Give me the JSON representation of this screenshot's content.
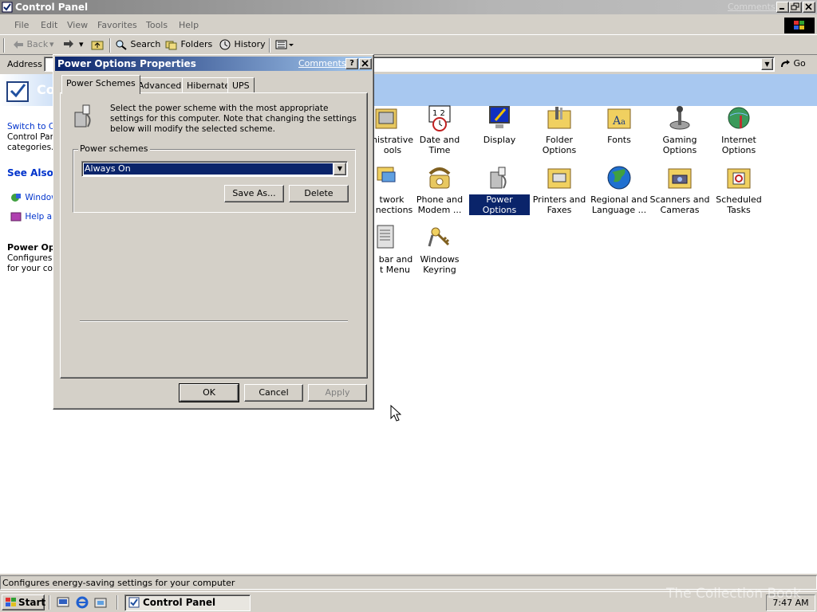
{
  "main_window": {
    "title": "Control Panel",
    "comments_link": "Comments?",
    "menu": [
      "File",
      "Edit",
      "View",
      "Favorites",
      "Tools",
      "Help"
    ],
    "toolbar": {
      "back": "Back",
      "search": "Search",
      "folders": "Folders",
      "history": "History"
    },
    "address_label": "Address",
    "go_label": "Go"
  },
  "sidebar": {
    "title": "Co",
    "switch_text_1": "Switch to C",
    "switch_text_2": "Control Pan",
    "switch_text_3": "categories.",
    "see_also": "See Also",
    "link_1": "Window",
    "link_2": "Help ar",
    "selected_title": "Power Opt",
    "selected_desc_1": "Configures",
    "selected_desc_2": "for your com"
  },
  "icons": [
    {
      "label_1": "nistrative",
      "label_2": "ools"
    },
    {
      "label_1": "Date and Time",
      "label_2": ""
    },
    {
      "label_1": "Display",
      "label_2": ""
    },
    {
      "label_1": "Folder Options",
      "label_2": ""
    },
    {
      "label_1": "Fonts",
      "label_2": ""
    },
    {
      "label_1": "Gaming",
      "label_2": "Options"
    },
    {
      "label_1": "Internet",
      "label_2": "Options"
    },
    {
      "label_1": "twork",
      "label_2": "nections"
    },
    {
      "label_1": "Phone and",
      "label_2": "Modem ..."
    },
    {
      "label_1": "Power Options",
      "label_2": ""
    },
    {
      "label_1": "Printers and",
      "label_2": "Faxes"
    },
    {
      "label_1": "Regional and",
      "label_2": "Language ..."
    },
    {
      "label_1": "Scanners and",
      "label_2": "Cameras"
    },
    {
      "label_1": "Scheduled",
      "label_2": "Tasks"
    },
    {
      "label_1": "bar and",
      "label_2": "t Menu"
    },
    {
      "label_1": "Windows",
      "label_2": "Keyring"
    }
  ],
  "dialog": {
    "title": "Power Options Properties",
    "comments_link": "Comments?",
    "tabs": [
      "Power Schemes",
      "Advanced",
      "Hibernate",
      "UPS"
    ],
    "description": "Select the power scheme with the most appropriate settings for this computer. Note that changing the settings below will modify the selected scheme.",
    "group_label": "Power schemes",
    "selected_scheme": "Always On",
    "save_as": "Save As...",
    "delete": "Delete",
    "ok": "OK",
    "cancel": "Cancel",
    "apply": "Apply"
  },
  "status_text": "Configures energy-saving settings for your computer",
  "taskbar": {
    "start": "Start",
    "task": "Control Panel",
    "clock": "7:47 AM"
  },
  "watermark": "The Collection Book",
  "colors": {
    "titlebar_active": "#0a246a",
    "selection": "#0a246a",
    "face": "#d4d0c8"
  }
}
